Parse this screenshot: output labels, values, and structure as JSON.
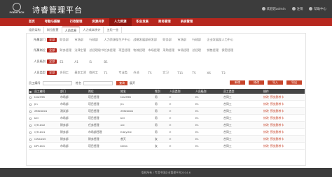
{
  "header": {
    "logo_text": "POEMTECH",
    "title": "诗睿管理平台",
    "welcome": "欢迎您admin",
    "logout": "注销",
    "help": "帮助中心"
  },
  "nav": {
    "items": [
      "首页",
      "考勤与薪酬",
      "行政管理",
      "资源共享",
      "人力资源",
      "职业发展",
      "财务管理",
      "系统管理"
    ],
    "active_index": 4
  },
  "breadcrumb": [
    "组织架构",
    "岗位配置",
    "人员信息",
    "人力成本统计",
    "五险一金"
  ],
  "filters": [
    {
      "label": "所属部门",
      "all": "全部",
      "options": [
        "财务部",
        "市场部",
        "行政部",
        "人力资源部",
        "生产中心",
        "战略发展部",
        "研发部",
        "财务部",
        "市场部",
        "行政部",
        "企业发展部",
        "人力中心"
      ]
    },
    {
      "label": "所属岗位",
      "all": "全部",
      "options": [
        "财务经理",
        "法律主管",
        "总经理秘书",
        "任务经理",
        "项目经理",
        "物流经理",
        "市场经理",
        "采购经理",
        "市场经理",
        "总经理",
        "销售经理",
        "保密经理"
      ]
    },
    {
      "label": "人员级别",
      "all": "全部",
      "options": [
        "E1",
        "A1",
        "I1",
        "B1"
      ]
    },
    {
      "label": "人员类型",
      "all": "全部",
      "options": [
        "合同工",
        "基本工资",
        "临时工",
        "T1",
        "专业类",
        "外派",
        "T5",
        "实习",
        "T11",
        "T5",
        "X6",
        "T3"
      ]
    }
  ],
  "search": {
    "name_label": "员工编号",
    "name_placeholder": "",
    "extra_label": "姓名",
    "extra_placeholder": "",
    "button": "查询",
    "advanced": "展开"
  },
  "actions": [
    "新增",
    "修改",
    "导入",
    "导出"
  ],
  "table": {
    "columns": [
      "",
      "员工编号",
      "部门",
      "岗位",
      "姓名",
      "性别",
      "人员类别",
      "人员级别",
      "员工类型",
      "操作"
    ],
    "rows": [
      [
        "test998",
        "市场部",
        "项目经理",
        "test998",
        "男",
        "E",
        "E1",
        "合同工"
      ],
      [
        "Jin",
        "市场部",
        "项目经理",
        "Jin",
        "男",
        "E",
        "E1",
        "合同工"
      ],
      [
        "XM00001",
        "测试部",
        "项目经理",
        "XM00001",
        "男",
        "E",
        "E1",
        "合同工"
      ],
      [
        "bill",
        "市场部",
        "项目经理",
        "bill",
        "男",
        "E",
        "E1",
        "合同工"
      ],
      [
        "QT1002",
        "财务部",
        "任务经理",
        "xie",
        "男",
        "E",
        "E1",
        "合同工"
      ],
      [
        "QT1001",
        "财务部",
        "市场部经理",
        "EddyXie",
        "男",
        "E",
        "E1",
        "合同工"
      ],
      [
        "CW1005",
        "财务部",
        "财务经理",
        "曾天",
        "女",
        "E",
        "E1",
        "合同工"
      ],
      [
        "DP1001",
        "市场部",
        "项目经理",
        "Della",
        "女",
        "E",
        "E1",
        "合同工"
      ]
    ],
    "row_actions": [
      "修改",
      "预览删养卡"
    ]
  },
  "footer": "版权所有 / 专用中国企业管理平台2014.6"
}
